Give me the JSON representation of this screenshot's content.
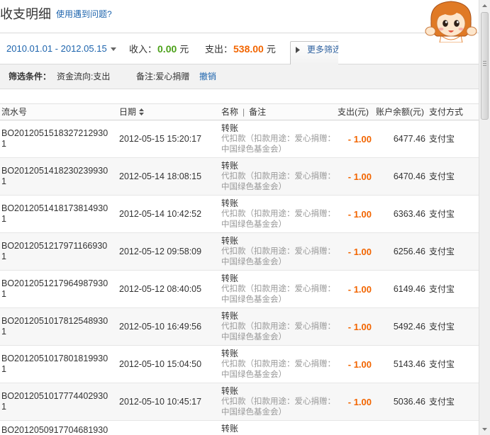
{
  "header": {
    "title": "收支明细",
    "help_link": "使用遇到问题?"
  },
  "summary": {
    "date_range": "2010.01.01 - 2012.05.15",
    "income_label": "收入：",
    "income_value": "0.00",
    "expense_label": "支出：",
    "expense_value": "538.00",
    "currency_unit": "元",
    "more_filter_label": "更多筛选"
  },
  "filter": {
    "label": "筛选条件：",
    "conditions": [
      "资金流向:支出",
      "备注:爱心捐赠"
    ],
    "cancel_label": "撤销"
  },
  "table": {
    "columns": {
      "serial": "流水号",
      "date": "日期",
      "name": "名称",
      "separator": "|",
      "remark": "备注",
      "expense": "支出(元)",
      "balance": "账户余额(元)",
      "payment_method": "支付方式"
    },
    "rows": [
      {
        "serial": "BO20120515183272129301",
        "date": "2012-05-15 15:20:17",
        "name": "转账",
        "remark": "代扣款（扣款用途：爱心捐赠：中国绿色基金会）",
        "amount": "- 1.00",
        "balance": "6477.46",
        "method": "支付宝"
      },
      {
        "serial": "BO20120514182302399301",
        "date": "2012-05-14 18:08:15",
        "name": "转账",
        "remark": "代扣款（扣款用途：爱心捐赠：中国绿色基金会）",
        "amount": "- 1.00",
        "balance": "6470.46",
        "method": "支付宝"
      },
      {
        "serial": "BO20120514181738149301",
        "date": "2012-05-14 10:42:52",
        "name": "转账",
        "remark": "代扣款（扣款用途：爱心捐赠：中国绿色基金会）",
        "amount": "- 1.00",
        "balance": "6363.46",
        "method": "支付宝"
      },
      {
        "serial": "BO20120512179711669301",
        "date": "2012-05-12 09:58:09",
        "name": "转账",
        "remark": "代扣款（扣款用途：爱心捐赠：中国绿色基金会）",
        "amount": "- 1.00",
        "balance": "6256.46",
        "method": "支付宝"
      },
      {
        "serial": "BO20120512179649879301",
        "date": "2012-05-12 08:40:05",
        "name": "转账",
        "remark": "代扣款（扣款用途：爱心捐赠：中国绿色基金会）",
        "amount": "- 1.00",
        "balance": "6149.46",
        "method": "支付宝"
      },
      {
        "serial": "BO20120510178125489301",
        "date": "2012-05-10 16:49:56",
        "name": "转账",
        "remark": "代扣款（扣款用途：爱心捐赠：中国绿色基金会）",
        "amount": "- 1.00",
        "balance": "5492.46",
        "method": "支付宝"
      },
      {
        "serial": "BO20120510178018199301",
        "date": "2012-05-10 15:04:50",
        "name": "转账",
        "remark": "代扣款（扣款用途：爱心捐赠：中国绿色基金会）",
        "amount": "- 1.00",
        "balance": "5143.46",
        "method": "支付宝"
      },
      {
        "serial": "BO20120510177744029301",
        "date": "2012-05-10 10:45:17",
        "name": "转账",
        "remark": "代扣款（扣款用途：爱心捐赠：中国绿色基金会）",
        "amount": "- 1.00",
        "balance": "5036.46",
        "method": "支付宝"
      }
    ],
    "partial_row": {
      "serial": "BO2012050917704681930",
      "name": "转账"
    }
  },
  "icons": {
    "date_range_dropdown": "caret-down-icon",
    "date_sort": "sort-icon",
    "more_filter": "play-icon",
    "assistant": "cartoon-girl-avatar",
    "scroll_up": "arrow-up-icon",
    "scroll_down": "arrow-down-icon"
  },
  "colors": {
    "link": "#1d64ad",
    "income": "#4ca11a",
    "expense": "#f26500",
    "remark_text": "#999999"
  }
}
